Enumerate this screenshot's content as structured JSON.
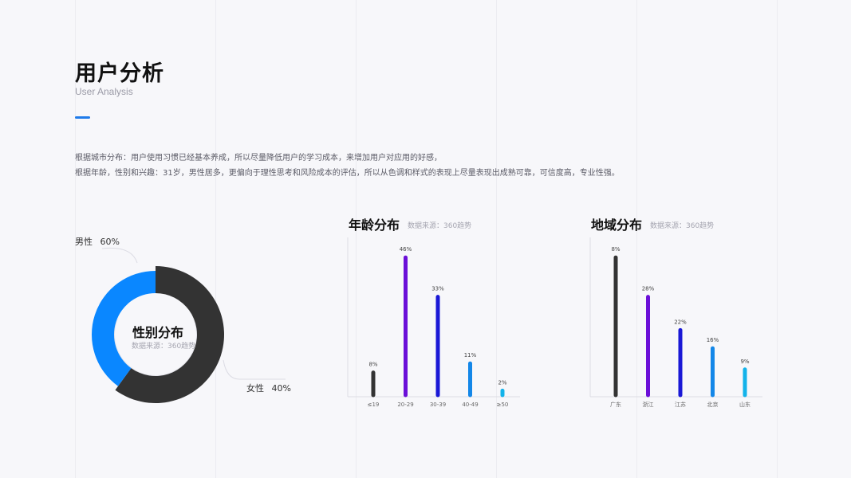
{
  "header": {
    "title": "用户分析",
    "subtitle": "User Analysis"
  },
  "description": [
    "根据城市分布：用户使用习惯已经基本养成，所以尽量降低用户的学习成本，来增加用户对应用的好感，",
    "根据年龄，性别和兴趣：31岁，男性居多，更偏向于理性思考和风险成本的评估，所以从色调和样式的表现上尽量表现出成熟可靠，可信度高，专业性强。"
  ],
  "colors": {
    "accent": "#1f7bea",
    "dark": "#333333",
    "purple": "#6b0fd8",
    "indigo": "#1a18d6",
    "blue": "#1487e8",
    "cyan": "#13b3ea",
    "pie_blue": "#0a87ff"
  },
  "chart_data": [
    {
      "type": "pie",
      "variant": "donut",
      "title": "性别分布",
      "source": "数据来源：360趋势",
      "slices": [
        {
          "label": "男性",
          "value": 60,
          "display": "60%",
          "color": "#333333"
        },
        {
          "label": "女性",
          "value": 40,
          "display": "40%",
          "color": "#0a87ff"
        }
      ]
    },
    {
      "type": "bar",
      "title": "年龄分布",
      "source": "数据来源：360趋势",
      "categories": [
        "≤19",
        "20-29",
        "30-39",
        "40-49",
        "≥50"
      ],
      "values": [
        8,
        46,
        33,
        11,
        2
      ],
      "labels": [
        "8%",
        "46%",
        "33%",
        "11%",
        "2%"
      ],
      "colors": [
        "#333333",
        "#6b0fd8",
        "#1a18d6",
        "#1487e8",
        "#13b3ea"
      ],
      "ylim": [
        0,
        50
      ]
    },
    {
      "type": "bar",
      "title": "地域分布",
      "source": "数据来源：360趋势",
      "categories": [
        "广东",
        "浙江",
        "江苏",
        "北京",
        "山东"
      ],
      "values": [
        46,
        33,
        22,
        16,
        9
      ],
      "labels": [
        "8%",
        "28%",
        "22%",
        "16%",
        "9%"
      ],
      "colors": [
        "#333333",
        "#6b0fd8",
        "#1a18d6",
        "#1487e8",
        "#13b3ea"
      ],
      "ylim": [
        0,
        50
      ]
    }
  ]
}
